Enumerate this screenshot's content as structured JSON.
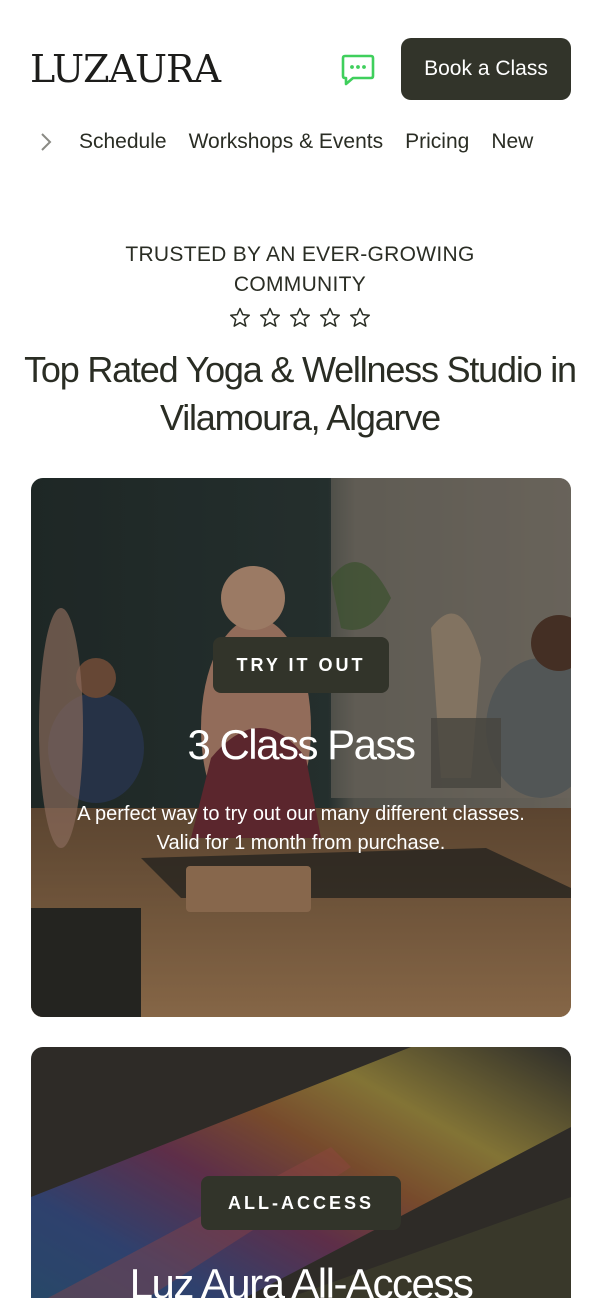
{
  "header": {
    "logo_text": "LUZAURA",
    "book_button_label": "Book a Class",
    "chat_icon": "chat-bubble-icon",
    "accent_color": "#3fcf5c"
  },
  "nav": {
    "chevron_icon": "chevron-right-icon",
    "items": [
      "Schedule",
      "Workshops & Events",
      "Pricing",
      "New"
    ]
  },
  "hero": {
    "trusted_text": "TRUSTED BY AN EVER-GROWING COMMUNITY",
    "star_icon": "star-outline-icon",
    "stars_count": 5,
    "headline": "Top Rated Yoga & Wellness Studio in Vilamoura, Algarve"
  },
  "cards": [
    {
      "badge": "TRY IT OUT",
      "title": "3 Class Pass",
      "description": "A perfect way to try out our many different classes. Valid for 1 month from purchase."
    },
    {
      "badge": "ALL-ACCESS",
      "title": "Luz Aura All-Access"
    }
  ],
  "colors": {
    "dark_button": "#32342a",
    "text": "#2a2d24"
  }
}
